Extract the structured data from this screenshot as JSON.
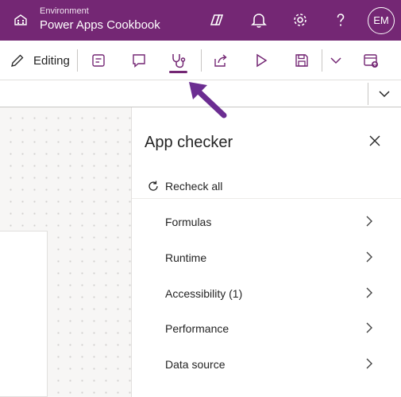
{
  "header": {
    "environment_label": "Environment",
    "environment_name": "Power Apps Cookbook",
    "avatar_initials": "EM",
    "background_color": "#742774",
    "icons": [
      "environment-icon",
      "copilot-icon",
      "bell-icon",
      "gear-icon",
      "help-icon"
    ]
  },
  "toolbar": {
    "editing_label": "Editing",
    "active_tool": "app-checker-stethoscope-icon",
    "icons": [
      "pencil-icon",
      "notes-icon",
      "comment-icon",
      "stethoscope-icon",
      "share-icon",
      "play-icon",
      "save-icon",
      "chevron-down-icon",
      "publish-icon"
    ],
    "accent_color": "#742774"
  },
  "app_checker": {
    "title": "App checker",
    "recheck_label": "Recheck all",
    "items": [
      {
        "label": "Formulas"
      },
      {
        "label": "Runtime"
      },
      {
        "label": "Accessibility (1)"
      },
      {
        "label": "Performance"
      },
      {
        "label": "Data source"
      }
    ]
  },
  "annotation": {
    "arrow_color": "#6b2d91"
  }
}
